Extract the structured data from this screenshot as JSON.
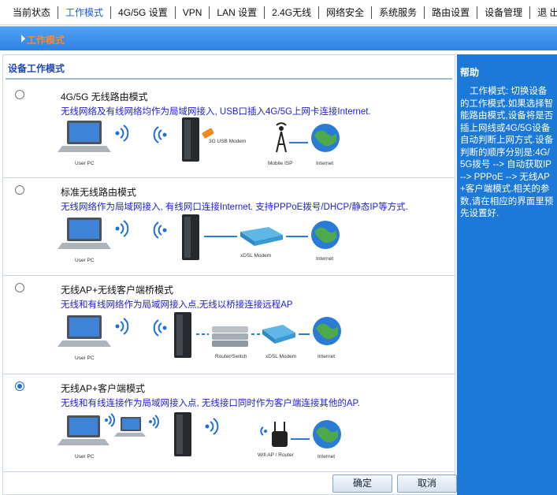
{
  "nav": {
    "items": [
      "当前状态",
      "工作模式",
      "4G/5G 设置",
      "VPN",
      "LAN 设置",
      "2.4G无线",
      "网络安全",
      "系统服务",
      "路由设置",
      "设备管理",
      "退 出"
    ],
    "active_index": 1
  },
  "bar": {
    "title": "工作模式"
  },
  "section": {
    "title": "设备工作模式"
  },
  "modes": [
    {
      "name": "4G/5G 无线路由模式",
      "desc": "无线网络及有线网络均作为局域网接入, USB口插入4G/5G上网卡连接Internet.",
      "selected": false,
      "captions": {
        "pc": "User PC",
        "modem": "3G USB Modem",
        "isp": "Mobile ISP",
        "internet": "Internet"
      }
    },
    {
      "name": "标准无线路由模式",
      "desc": "无线网络作为局域网接入, 有线网口连接Internet. 支持PPPoE拨号/DHCP/静态IP等方式.",
      "selected": false,
      "captions": {
        "pc": "User PC",
        "xdsl": "xDSL Modem",
        "internet": "Internet"
      }
    },
    {
      "name": "无线AP+无线客户端桥模式",
      "desc": "无线和有线网络作为局域网接入点,无线以桥接连接远程AP",
      "selected": false,
      "captions": {
        "pc": "User PC",
        "switch": "Router/Switch",
        "xdsl": "xDSL Modem",
        "internet": "Internet"
      }
    },
    {
      "name": "无线AP+客户端模式",
      "desc": "无线和有线连接作为局域网接入点, 无线接口同时作为客户端连接其他的AP.",
      "selected": true,
      "captions": {
        "pc": "User PC",
        "wifi": "Wifi AP / Router",
        "internet": "Internet"
      }
    }
  ],
  "buttons": {
    "ok": "确定",
    "cancel": "取消"
  },
  "help": {
    "title": "帮助",
    "text": "工作模式: 切换设备的工作模式.如果选择智能路由模式,设备将是否插上网线或4G/5G设备自动判断上网方式.设备判断的顺序分别是:4G/5G拨号 --> 自动获取IP --> PPPoE --> 无线AP+客户端模式.相关的参数,请在相应的界面里预先设置好."
  },
  "colors": {
    "accent": "#1d79d8",
    "title_orange": "#ff8a1c",
    "desc_blue": "#2121d6"
  }
}
